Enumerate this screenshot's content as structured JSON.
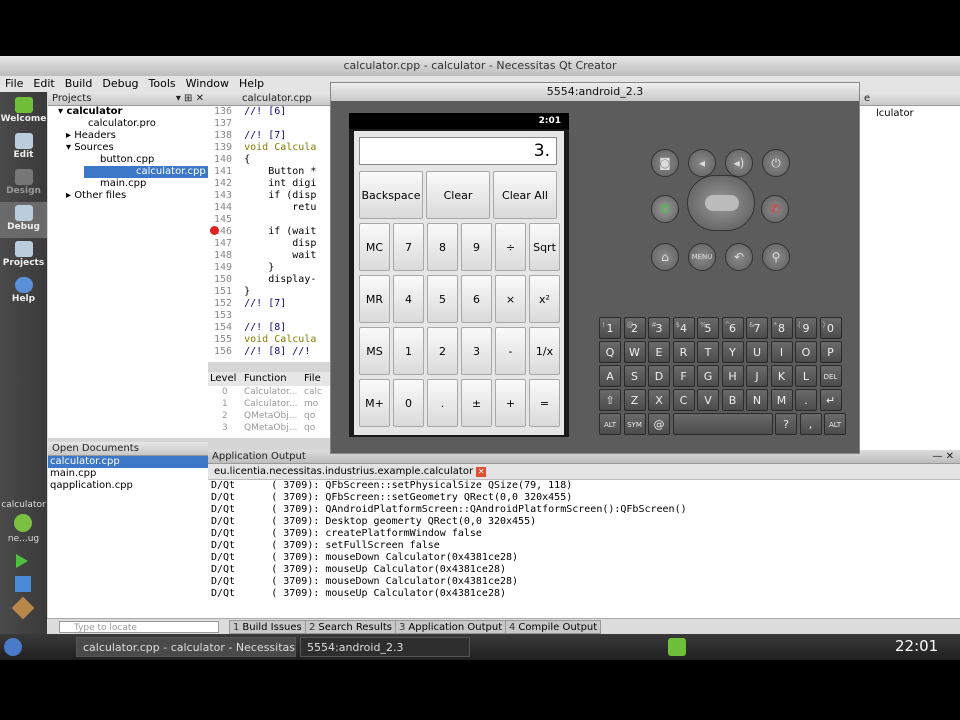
{
  "window": {
    "title": "calculator.cpp - calculator - Necessitas Qt Creator"
  },
  "menu": [
    "File",
    "Edit",
    "Build",
    "Debug",
    "Tools",
    "Window",
    "Help"
  ],
  "modes": [
    "Welcome",
    "Edit",
    "Design",
    "Debug",
    "Projects",
    "Help"
  ],
  "projects": {
    "header": "Projects",
    "root": "calculator",
    "items": [
      "calculator.pro",
      "Headers",
      "Sources",
      "button.cpp",
      "calculator.cpp",
      "main.cpp",
      "Other files"
    ]
  },
  "editor": {
    "tab": "calculator.cpp",
    "lines": [
      {
        "n": "136",
        "t": "//! [6]"
      },
      {
        "n": "137",
        "t": ""
      },
      {
        "n": "138",
        "t": "//! [7]"
      },
      {
        "n": "139",
        "t": "void Calcula"
      },
      {
        "n": "140",
        "t": "{"
      },
      {
        "n": "141",
        "t": "    Button *"
      },
      {
        "n": "142",
        "t": "    int digi"
      },
      {
        "n": "143",
        "t": "    if (disp"
      },
      {
        "n": "144",
        "t": "        retu"
      },
      {
        "n": "145",
        "t": ""
      },
      {
        "n": "146",
        "t": "    if (wait"
      },
      {
        "n": "147",
        "t": "        disp"
      },
      {
        "n": "148",
        "t": "        wait"
      },
      {
        "n": "149",
        "t": "    }"
      },
      {
        "n": "150",
        "t": "    display-"
      },
      {
        "n": "151",
        "t": "}"
      },
      {
        "n": "152",
        "t": "//! [7]"
      },
      {
        "n": "153",
        "t": ""
      },
      {
        "n": "154",
        "t": "//! [8]"
      },
      {
        "n": "155",
        "t": "void Calcula"
      },
      {
        "n": "156",
        "t": "//! [8] //!"
      }
    ]
  },
  "stack": {
    "headers": [
      "Level",
      "Function",
      "File"
    ],
    "rows": [
      [
        "0",
        "Calculator...",
        "calc"
      ],
      [
        "1",
        "Calculator...",
        "mo"
      ],
      [
        "2",
        "QMetaObj...",
        "qo"
      ],
      [
        "3",
        "QMetaObj...",
        "qo"
      ]
    ]
  },
  "open_docs": {
    "header": "Open Documents",
    "items": [
      "calculator.cpp",
      "main.cpp",
      "qapplication.cpp"
    ]
  },
  "left_bottom": {
    "target": "calculator",
    "build": "ne...ug"
  },
  "output": {
    "header": "Application Output",
    "tab": "eu.licentia.necessitas.industrius.example.calculator",
    "lines": [
      "D/Qt      ( 3709): QFbScreen::setPhysicalSize QSize(79, 118)",
      "D/Qt      ( 3709): QFbScreen::setGeometry QRect(0,0 320x455)",
      "D/Qt      ( 3709): QAndroidPlatformScreen::QAndroidPlatformScreen():QFbScreen()",
      "D/Qt      ( 3709): Desktop geomerty QRect(0,0 320x455)",
      "D/Qt      ( 3709): createPlatformWindow false",
      "D/Qt      ( 3709): setFullScreen false",
      "D/Qt      ( 3709): mouseDown Calculator(0x4381ce28)",
      "D/Qt      ( 3709): mouseUp Calculator(0x4381ce28)",
      "D/Qt      ( 3709): mouseDown Calculator(0x4381ce28)",
      "D/Qt      ( 3709): mouseUp Calculator(0x4381ce28)"
    ]
  },
  "status": {
    "search_placeholder": "Type to locate",
    "panes": [
      {
        "n": "1",
        "label": "Build Issues"
      },
      {
        "n": "2",
        "label": "Search Results"
      },
      {
        "n": "3",
        "label": "Application Output"
      },
      {
        "n": "4",
        "label": "Compile Output"
      }
    ]
  },
  "taskbar": {
    "tasks": [
      "calculator.cpp - calculator - Necessitas Q",
      "5554:android_2.3"
    ],
    "clock": "22:01"
  },
  "emulator": {
    "title": "5554:android_2.3",
    "phone_time": "2:01",
    "display": "3.",
    "calc_rows": [
      [
        "Backspace",
        "Clear",
        "Clear All"
      ],
      [
        "MC",
        "7",
        "8",
        "9",
        "÷",
        "Sqrt"
      ],
      [
        "MR",
        "4",
        "5",
        "6",
        "×",
        "x²"
      ],
      [
        "MS",
        "1",
        "2",
        "3",
        "-",
        "1/x"
      ],
      [
        "M+",
        "0",
        ".",
        "±",
        "+",
        "="
      ]
    ],
    "hw_row1": [
      "camera-icon",
      "volume-down-icon",
      "volume-up-icon",
      "power-icon"
    ],
    "hw_row3": [
      "home-icon",
      "MENU",
      "back-icon",
      "search-icon"
    ],
    "keyboard": [
      [
        {
          "k": "1",
          "s": "!"
        },
        {
          "k": "2",
          "s": "@"
        },
        {
          "k": "3",
          "s": "#"
        },
        {
          "k": "4",
          "s": "$"
        },
        {
          "k": "5",
          "s": "%"
        },
        {
          "k": "6",
          "s": "^"
        },
        {
          "k": "7",
          "s": "&"
        },
        {
          "k": "8",
          "s": "*"
        },
        {
          "k": "9",
          "s": "("
        },
        {
          "k": "0",
          "s": ")"
        }
      ],
      [
        {
          "k": "Q"
        },
        {
          "k": "W"
        },
        {
          "k": "E"
        },
        {
          "k": "R"
        },
        {
          "k": "T"
        },
        {
          "k": "Y"
        },
        {
          "k": "U"
        },
        {
          "k": "I"
        },
        {
          "k": "O"
        },
        {
          "k": "P"
        }
      ],
      [
        {
          "k": "A"
        },
        {
          "k": "S"
        },
        {
          "k": "D"
        },
        {
          "k": "F"
        },
        {
          "k": "G"
        },
        {
          "k": "H"
        },
        {
          "k": "J"
        },
        {
          "k": "K"
        },
        {
          "k": "L"
        },
        {
          "k": "DEL"
        }
      ],
      [
        {
          "k": "⇧"
        },
        {
          "k": "Z"
        },
        {
          "k": "X"
        },
        {
          "k": "C"
        },
        {
          "k": "V"
        },
        {
          "k": "B"
        },
        {
          "k": "N"
        },
        {
          "k": "M"
        },
        {
          "k": "."
        },
        {
          "k": "↵"
        }
      ],
      [
        {
          "k": "ALT"
        },
        {
          "k": "SYM"
        },
        {
          "k": "@"
        },
        {
          "k": ""
        },
        {
          "k": "?"
        },
        {
          "k": ","
        },
        {
          "k": "ALT"
        }
      ]
    ]
  },
  "bg_right": {
    "label1": "e",
    "label2": "lculator"
  },
  "colors": {
    "selection": "#3c77c8",
    "desktop": "#000000"
  }
}
